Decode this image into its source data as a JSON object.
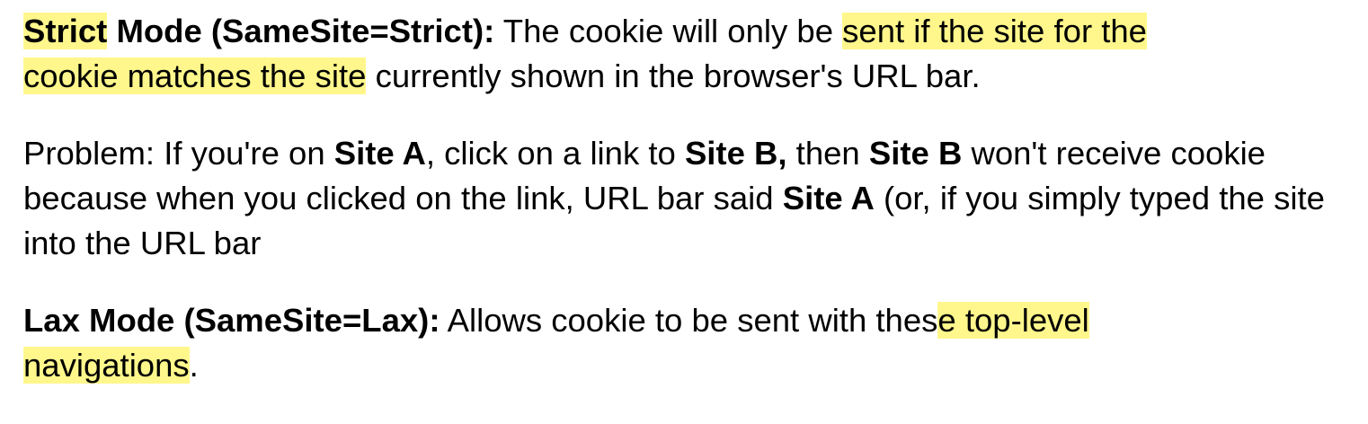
{
  "highlight_color": "#fff78c",
  "text_color": "#000000",
  "paragraphs": {
    "strict": {
      "term": "Strict",
      "title_rest": " Mode (SameSite=Strict):",
      "text1": " The cookie will only be ",
      "highlight1": "sent if the site for the ",
      "highlight2": "cookie matches the site",
      "text2": " currently shown in the browser's URL bar."
    },
    "problem": {
      "t1": "Problem: If you're on ",
      "b1": "Site A",
      "t2": ", click on a link to ",
      "b2": "Site B,",
      "t3": " then ",
      "b3": "Site B",
      "t4": " won't receive cookie because when you clicked on the link, URL bar said ",
      "b4": "Site A",
      "t5": " (or, if you simply typed the site into the URL bar"
    },
    "lax": {
      "title": "Lax Mode (SameSite=Lax):",
      "text1": " Allows cookie to be sent with thes",
      "highlight1": "e top-level ",
      "highlight2": "navigations",
      "text2": "."
    }
  }
}
